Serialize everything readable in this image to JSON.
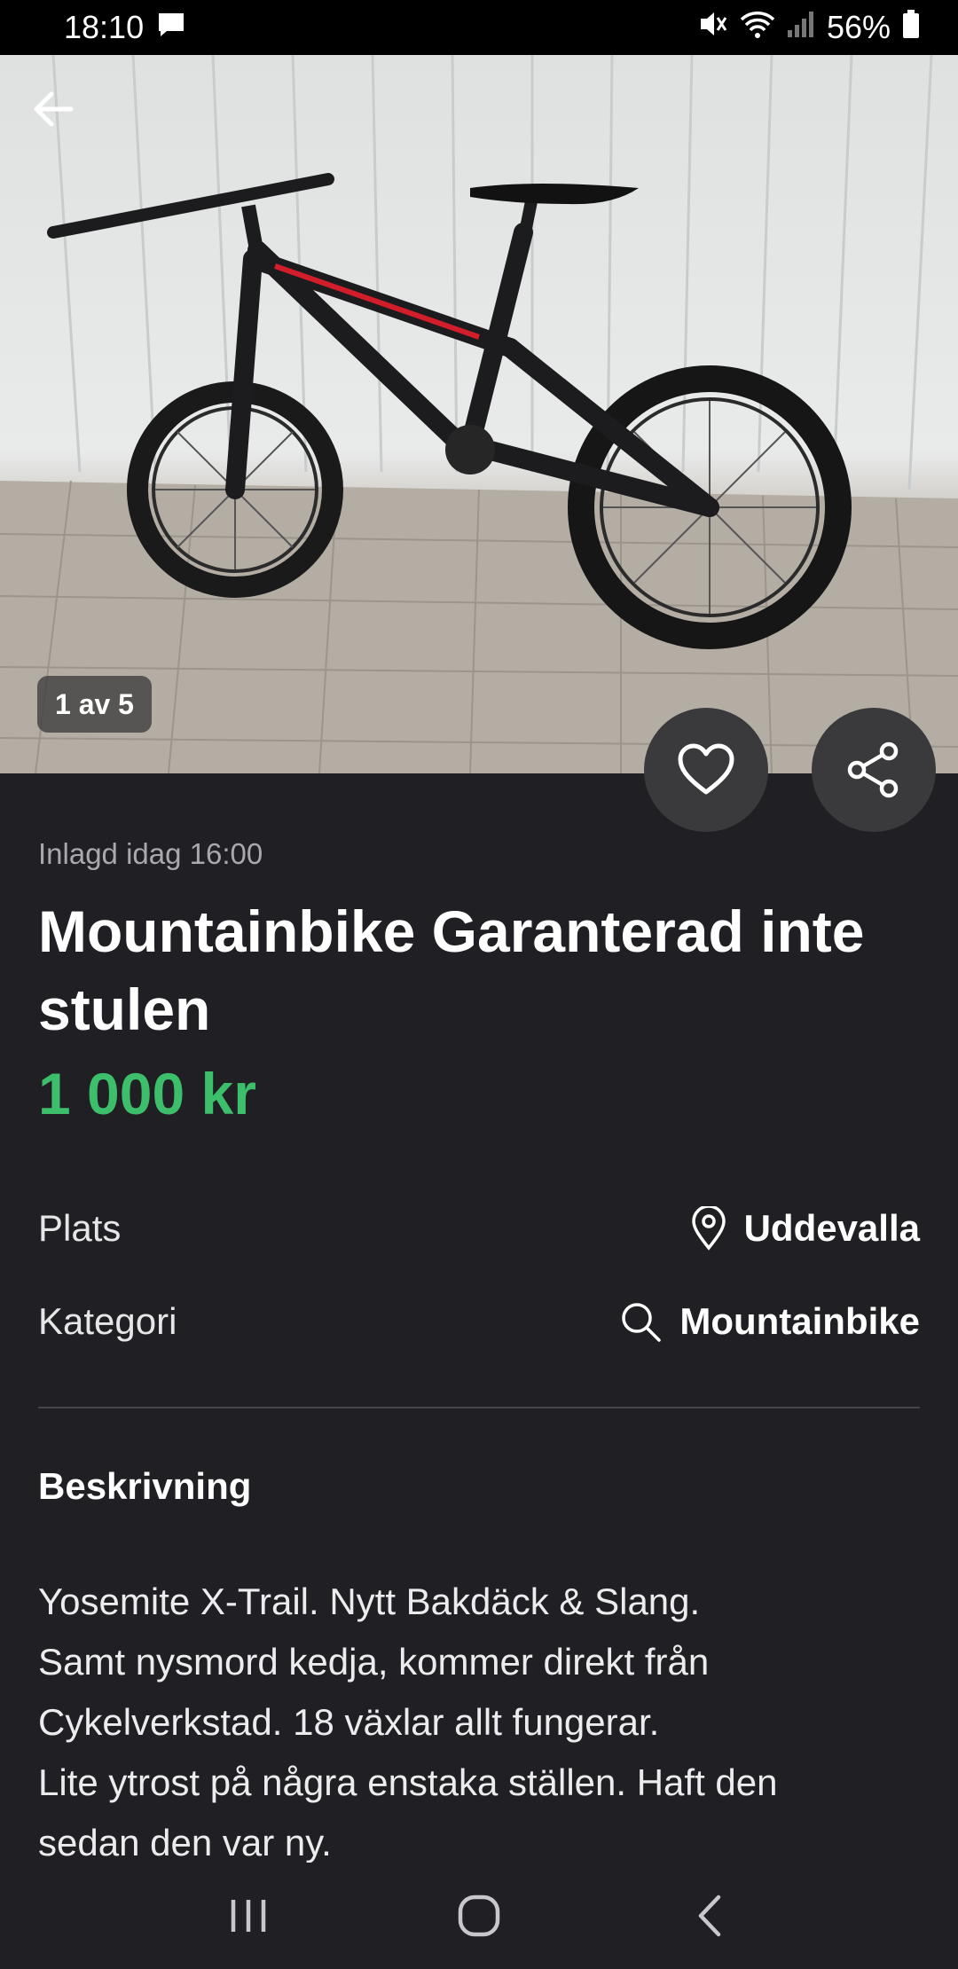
{
  "status_bar": {
    "time": "18:10",
    "battery": "56%",
    "icons": [
      "message-icon",
      "mute-icon",
      "wifi-icon",
      "signal-icon",
      "battery-icon"
    ]
  },
  "photo": {
    "counter": "1 av 5",
    "back_icon": "arrow-left-icon"
  },
  "actions": {
    "favorite_icon": "heart-icon",
    "share_icon": "share-icon"
  },
  "listing": {
    "posted": "Inlagd idag 16:00",
    "title": "Mountainbike Garanterad inte stulen",
    "price": "1 000 kr",
    "price_color": "#3dbe6b"
  },
  "details": {
    "plats_label": "Plats",
    "plats_value": "Uddevalla",
    "plats_icon": "location-pin-icon",
    "kategori_label": "Kategori",
    "kategori_value": "Mountainbike",
    "kategori_icon": "search-icon"
  },
  "description": {
    "heading": "Beskrivning",
    "lines": [
      "Yosemite X-Trail. Nytt Bakdäck & Slang.",
      "Samt nysmord kedja, kommer direkt från",
      "Cykelverkstad. 18 växlar allt fungerar.",
      "Lite ytrost på några enstaka ställen. Haft den",
      "sedan den var ny."
    ]
  },
  "nav_bar": {
    "icons": [
      "recent-apps-icon",
      "home-icon",
      "back-icon"
    ]
  },
  "colors": {
    "background": "#202024",
    "accent_green": "#3dbe6b",
    "button_bg": "#3a3a3c"
  }
}
